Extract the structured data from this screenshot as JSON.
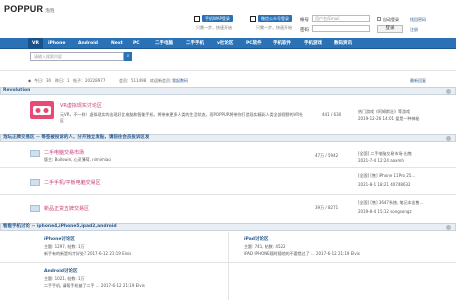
{
  "header": {
    "logo": "POPPUR",
    "logo_sub": "泡泡",
    "phone_btn": "手机WAP登录",
    "wechat_btn": "微信公众号登录",
    "small_note1": "只需一步，快速开始",
    "small_note2": "只需一步，快速开始",
    "account_label": "帐号",
    "account_placeholder": "用户名/Email",
    "password_label": "密码",
    "auto_login": "自动登录",
    "forgot": "找回密码",
    "login_btn": "登录",
    "register": "注册"
  },
  "nav": {
    "items": [
      "VR",
      "iPhone",
      "Android",
      "Next",
      "PC",
      "二手电脑",
      "二手手机",
      "v社论区",
      "PC软件",
      "手机软件",
      "手机游戏",
      "数码资讯"
    ]
  },
  "search": {
    "placeholder": "请输入搜索内容"
  },
  "stats": {
    "today_label": "今日:",
    "today": "30",
    "yesterday_label": "昨日:",
    "yesterday": "1",
    "posts_label": "帖子:",
    "posts": "20228977",
    "members_label": "会员:",
    "members": "511498",
    "welcome": "欢迎新会员:",
    "new_member": "我起数码",
    "latest": "最新回复"
  },
  "sections": [
    {
      "title": "Revolution",
      "forums": [
        {
          "name": "VR虚拟现实讨论区",
          "desc": "元VR，不一样！虚拟现实的出现好比电脑和智能手机，将带来更多人类的生活状态。而POPPUR将带你打造现实精彩人类全部视野的VR社区",
          "counts": "441 / 630",
          "last_title": "热门游戏《阿姆斯壮》等游戏",
          "last_time": "2019-12-26 14:01 爱是一种神秘"
        }
      ]
    },
    {
      "title": "泡坛正牌交易区 -- 等签被投诉的人，分开独立发贴，请前往会员投诉区发",
      "forums": [
        {
          "name": "二手电脑交易市场",
          "moderators": "版主: Bullswin, 心灵薄荷, nimimiao",
          "counts": "47万 / 5942",
          "last_title": "[全国] 二手电脑交易市场-出售",
          "last_time": "2021-7-4 12:24 aaxmh"
        },
        {
          "name": "二手手机/平板电脑交易区",
          "counts": "",
          "last_title": "[全国] [售] iPhone 11Pro 25...",
          "last_time": "2021-8-1 18:21 40748632"
        },
        {
          "name": "新品正货五牌交易区",
          "counts": "39万 / 8271",
          "last_title": "[全国] [售] 3647系统, 笔记本出售...",
          "last_time": "2019-8-4 15:12 songsongz"
        }
      ]
    },
    {
      "title": "智能手机讨论 -- iphone4,iPhone5,ipad2,android",
      "forums": [
        {
          "name": "iPhone讨论区",
          "stats": "主题: 1297, 帖数: 1万",
          "last": "新手有的新是吗才好处? 2017-6-12 21:19 Elvis"
        },
        {
          "name": "iPad讨论区",
          "stats": "主题: 741, 帖数: 4522",
          "last": "iPAD IPHONE随时随地的不要错过了 ... 2017-6-12 21:19 Elvis"
        },
        {
          "name": "Android讨论区",
          "stats": "主题: 1021, 帖数: 1万",
          "last": "二手手机, 请帮手机被了二手 ... 2017-6-12 21:19 Elvis"
        }
      ]
    }
  ]
}
